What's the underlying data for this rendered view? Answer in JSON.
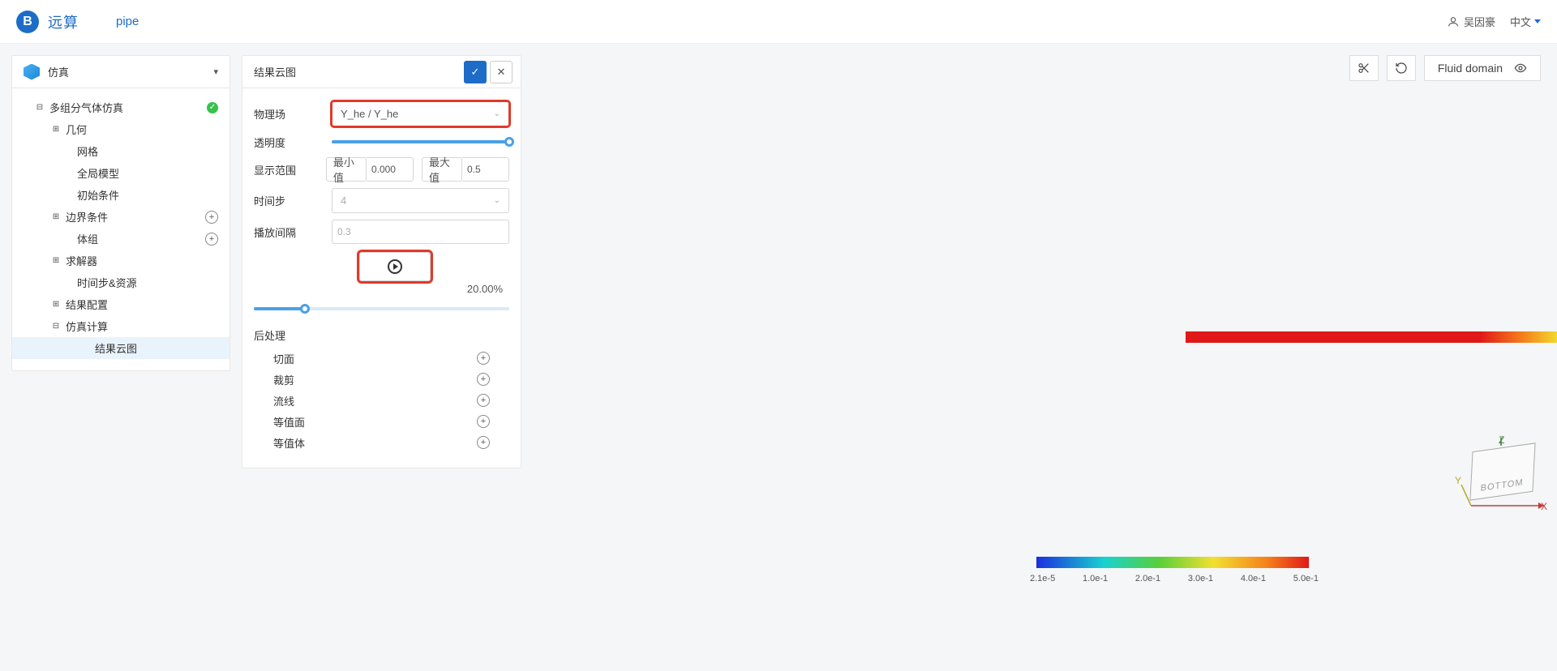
{
  "header": {
    "brand": "远算",
    "project": "pipe",
    "user": "吴因豪",
    "lang": "中文"
  },
  "tree": {
    "head": "仿真",
    "root": "多组分气体仿真",
    "geometry": "几何",
    "mesh": "网格",
    "global_model": "全局模型",
    "initial": "初始条件",
    "boundary": "边界条件",
    "volume_group": "体组",
    "solver": "求解器",
    "timestep_res": "时间步&资源",
    "result_cfg": "结果配置",
    "sim_run": "仿真计算",
    "contour": "结果云图"
  },
  "panel": {
    "title": "结果云图",
    "field_label": "物理场",
    "field_value": "Y_he / Y_he",
    "opacity_label": "透明度",
    "range_label": "显示范围",
    "min_btn": "最小值",
    "min_val": "0.000",
    "max_btn": "最大值",
    "max_val": "0.5",
    "timestep_label": "时间步",
    "timestep_val": "4",
    "interval_label": "播放间隔",
    "interval_val": "0.3",
    "progress_pct": "20.00%",
    "post_label": "后处理",
    "plane": "切面",
    "clip": "裁剪",
    "streamline": "流线",
    "iso_surface": "等值面",
    "iso_volume": "等值体"
  },
  "viewport": {
    "domain_name": "Fluid domain",
    "axis": {
      "x": "X",
      "y": "Y",
      "z": "Z",
      "cube_face": "BOTTOM"
    },
    "legend_ticks": [
      "2.1e-5",
      "1.0e-1",
      "2.0e-1",
      "3.0e-1",
      "4.0e-1",
      "5.0e-1"
    ]
  }
}
